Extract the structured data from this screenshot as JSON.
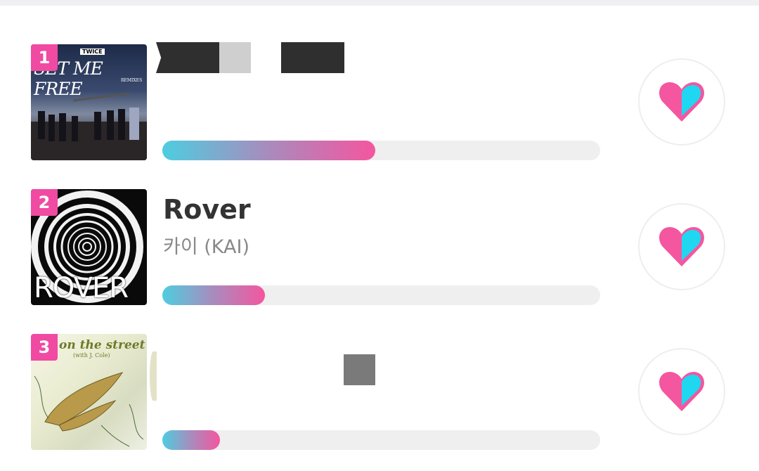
{
  "chart_rows": [
    {
      "rank": "1",
      "cover_text": "SET ME FREE",
      "cover_brand": "TWICE",
      "cover_sub": "REMIXES",
      "title": "",
      "artist": "",
      "vote_share": 0.486
    },
    {
      "rank": "2",
      "cover_text": "ROVER",
      "title": "Rover",
      "artist": "카이 (KAI)",
      "vote_share": 0.235
    },
    {
      "rank": "3",
      "cover_text": "on the street",
      "cover_sub": "(with J. Cole)",
      "title": "",
      "artist": "",
      "vote_share": 0.132
    }
  ],
  "colors": {
    "rank_badge": "#f04aa2",
    "heart_pink": "#f4569f",
    "heart_cyan": "#1fd7f0",
    "bar_start": "#4ecde0",
    "bar_end": "#f4569f"
  },
  "icons": {
    "vote": "heart-icon"
  }
}
